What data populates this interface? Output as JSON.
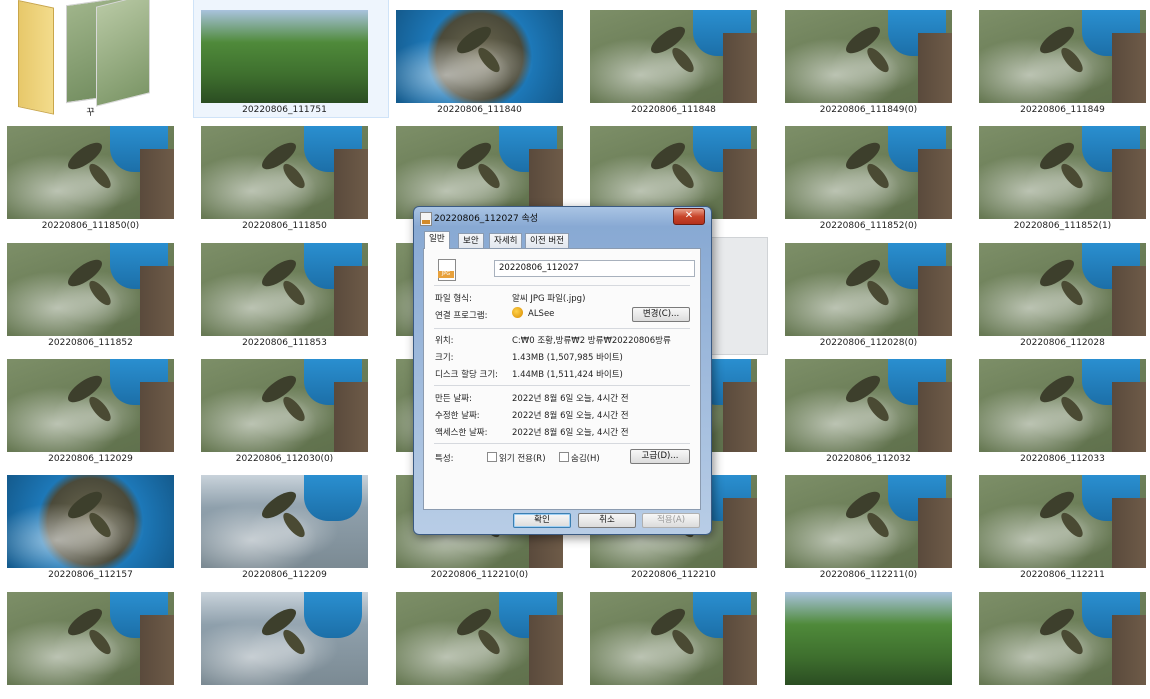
{
  "explorer": {
    "folder": {
      "label": "꾸"
    },
    "files": [
      {
        "name": "20220806_111751",
        "variant": "trees",
        "selected": true
      },
      {
        "name": "20220806_111840",
        "variant": "bucket-top"
      },
      {
        "name": "20220806_111848",
        "variant": "dock"
      },
      {
        "name": "20220806_111849(0)",
        "variant": "dock"
      },
      {
        "name": "20220806_111849",
        "variant": "dock"
      },
      {
        "name": "20220806_111850(0)",
        "variant": "dock"
      },
      {
        "name": "20220806_111850",
        "variant": "dock"
      },
      {
        "name": "",
        "variant": "dock"
      },
      {
        "name": "",
        "variant": "dock"
      },
      {
        "name": "20220806_111852(0)",
        "variant": "dock"
      },
      {
        "name": "20220806_111852(1)",
        "variant": "dock"
      },
      {
        "name": "20220806_111852",
        "variant": "dock"
      },
      {
        "name": "20220806_111853",
        "variant": "dock"
      },
      {
        "name": "",
        "variant": "dock"
      },
      {
        "name": "",
        "variant": "hidden"
      },
      {
        "name": "20220806_112028(0)",
        "variant": "dock"
      },
      {
        "name": "20220806_112028",
        "variant": "dock"
      },
      {
        "name": "20220806_112029",
        "variant": "dock"
      },
      {
        "name": "20220806_112030(0)",
        "variant": "dock"
      },
      {
        "name": "",
        "variant": "dock"
      },
      {
        "name": "",
        "variant": "dock"
      },
      {
        "name": "20220806_112032",
        "variant": "dock"
      },
      {
        "name": "20220806_112033",
        "variant": "dock"
      },
      {
        "name": "20220806_112157",
        "variant": "bucket-top"
      },
      {
        "name": "20220806_112209",
        "variant": "lake"
      },
      {
        "name": "20220806_112210(0)",
        "variant": "dock"
      },
      {
        "name": "20220806_112210",
        "variant": "dock"
      },
      {
        "name": "20220806_112211(0)",
        "variant": "dock"
      },
      {
        "name": "20220806_112211",
        "variant": "dock"
      },
      {
        "name": "",
        "variant": "dock"
      },
      {
        "name": "",
        "variant": "lake"
      },
      {
        "name": "",
        "variant": "dock"
      },
      {
        "name": "",
        "variant": "dock"
      },
      {
        "name": "",
        "variant": "trees"
      },
      {
        "name": "",
        "variant": "dock"
      }
    ]
  },
  "dialog": {
    "title": "20220806_112027 속성",
    "close_glyph": "✕",
    "tabs": [
      "일반",
      "보안",
      "자세히",
      "이전 버전"
    ],
    "file_icon_text": "JPG",
    "file_name": "20220806_112027",
    "rows": {
      "type_label": "파일 형식:",
      "type_value": "알씨 JPG 파일(.jpg)",
      "opens_label": "연결 프로그램:",
      "opens_value": "ALSee",
      "change_button": "변경(C)...",
      "location_label": "위치:",
      "location_value": "C:₩0 조황,방류₩2 방류₩20220806방류",
      "size_label": "크기:",
      "size_value": "1.43MB (1,507,985 바이트)",
      "disk_label": "디스크 할당 크기:",
      "disk_value": "1.44MB (1,511,424 바이트)",
      "created_label": "만든 날짜:",
      "created_value": "2022년 8월 6일 오늘, 4시간 전",
      "modified_label": "수정한 날짜:",
      "modified_value": "2022년 8월 6일 오늘, 4시간 전",
      "accessed_label": "액세스한 날짜:",
      "accessed_value": "2022년 8월 6일 오늘, 4시간 전",
      "attributes_label": "특성:",
      "readonly_label": "읽기 전용(R)",
      "hidden_label": "숨김(H)",
      "advanced_button": "고급(D)..."
    },
    "buttons": {
      "ok": "확인",
      "cancel": "취소",
      "apply": "적용(A)"
    }
  }
}
